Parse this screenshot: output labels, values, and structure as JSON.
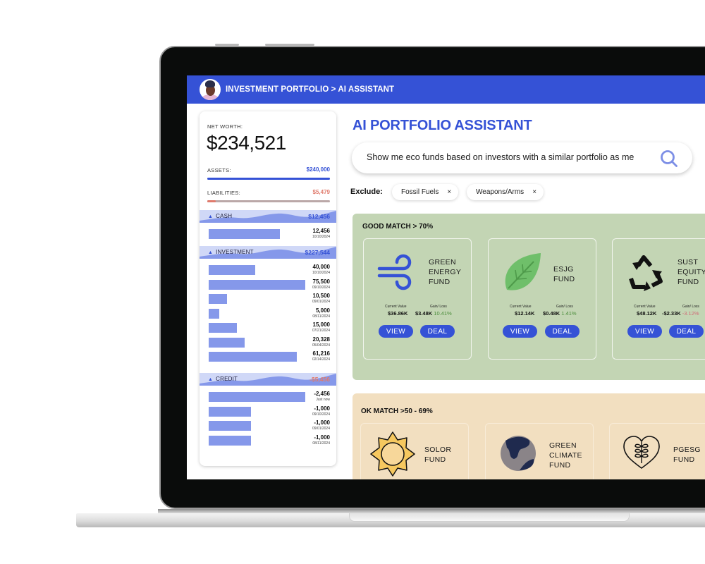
{
  "header": {
    "breadcrumb": "INVESTMENT PORTFOLIO > AI ASSISTANT",
    "avatar_icon": "user-avatar"
  },
  "summary": {
    "net_worth_label": "NET WORTH:",
    "net_worth_value": "$234,521",
    "assets_label": "ASSETS:",
    "assets_value": "$240,000",
    "assets_fill": 1.0,
    "liabilities_label": "LIABILITIES:",
    "liabilities_value": "$5,479",
    "liabilities_fill": 0.07
  },
  "accounts": [
    {
      "name": "CASH",
      "total": "$12,456",
      "total_color": "#3552d6",
      "transactions": [
        {
          "amount": "12,456",
          "date": "10/10/2024",
          "fill": 0.88
        }
      ]
    },
    {
      "name": "INVESTMENT",
      "total": "$227,544",
      "total_color": "#3552d6",
      "transactions": [
        {
          "amount": "40,000",
          "date": "10/10/2024",
          "fill": 0.48
        },
        {
          "amount": "75,500",
          "date": "09/10/2024",
          "fill": 1.0
        },
        {
          "amount": "10,500",
          "date": "09/01/2024",
          "fill": 0.19
        },
        {
          "amount": "5,000",
          "date": "08/11/2024",
          "fill": 0.11
        },
        {
          "amount": "15,000",
          "date": "07/21/2024",
          "fill": 0.29
        },
        {
          "amount": "20,328",
          "date": "05/04/2024",
          "fill": 0.37
        },
        {
          "amount": "61,216",
          "date": "02/14/2024",
          "fill": 0.91
        }
      ]
    },
    {
      "name": "CREDIT",
      "total": "-$5,456",
      "total_color": "#e07a6c",
      "transactions": [
        {
          "amount": "-2,456",
          "date": "Just now",
          "fill": 1.0
        },
        {
          "amount": "-1,000",
          "date": "09/10/2024",
          "fill": 0.44
        },
        {
          "amount": "-1,000",
          "date": "09/01/2024",
          "fill": 0.44
        },
        {
          "amount": "-1,000",
          "date": "08/11/2024",
          "fill": 0.44
        }
      ]
    }
  ],
  "main": {
    "title": "AI PORTFOLIO ASSISTANT",
    "search_value": "Show me eco funds based on investors with a similar portfolio as me",
    "search_icon": "search-icon",
    "exclude_label": "Exclude:",
    "exclusions": [
      {
        "label": "Fossil Fuels",
        "close": "×"
      },
      {
        "label": "Weapons/Arms",
        "close": "×"
      }
    ]
  },
  "groups": [
    {
      "title": "GOOD MATCH > 70%",
      "color": "#c3d5b4",
      "funds": [
        {
          "name": "GREEN\nENERGY\nFUND",
          "icon": "wind-icon",
          "current_value_label": "Current Value",
          "current_value": "$36.86K",
          "gain_label": "Gain/ Loss",
          "gain": "$3.48K",
          "gain_pct": "10.41%",
          "gain_dir": "pos",
          "view": "VIEW",
          "deal": "DEAL"
        },
        {
          "name": "ESJG\nFUND",
          "icon": "leaf-icon",
          "current_value_label": "Current Value",
          "current_value": "$12.14K",
          "gain_label": "Gain/ Loss",
          "gain": "$0.48K",
          "gain_pct": "1.41%",
          "gain_dir": "pos",
          "view": "VIEW",
          "deal": "DEAL"
        },
        {
          "name": "SUST\nEQUITY\nFUND",
          "icon": "recycle-icon",
          "current_value_label": "Current Value",
          "current_value": "$48.12K",
          "gain_label": "Gain/ Loss",
          "gain": "-$2.33K",
          "gain_pct": "-3.12%",
          "gain_dir": "neg",
          "view": "VIEW",
          "deal": "DEAL"
        }
      ]
    },
    {
      "title": "OK MATCH >50 - 69%",
      "color": "#f2dfc0",
      "funds": [
        {
          "name": "SOLOR\nFUND",
          "icon": "sun-icon"
        },
        {
          "name": "GREEN\nCLIMATE\nFUND",
          "icon": "globe-icon"
        },
        {
          "name": "PGESG\nFUND",
          "icon": "heart-plant-icon"
        }
      ]
    }
  ]
}
